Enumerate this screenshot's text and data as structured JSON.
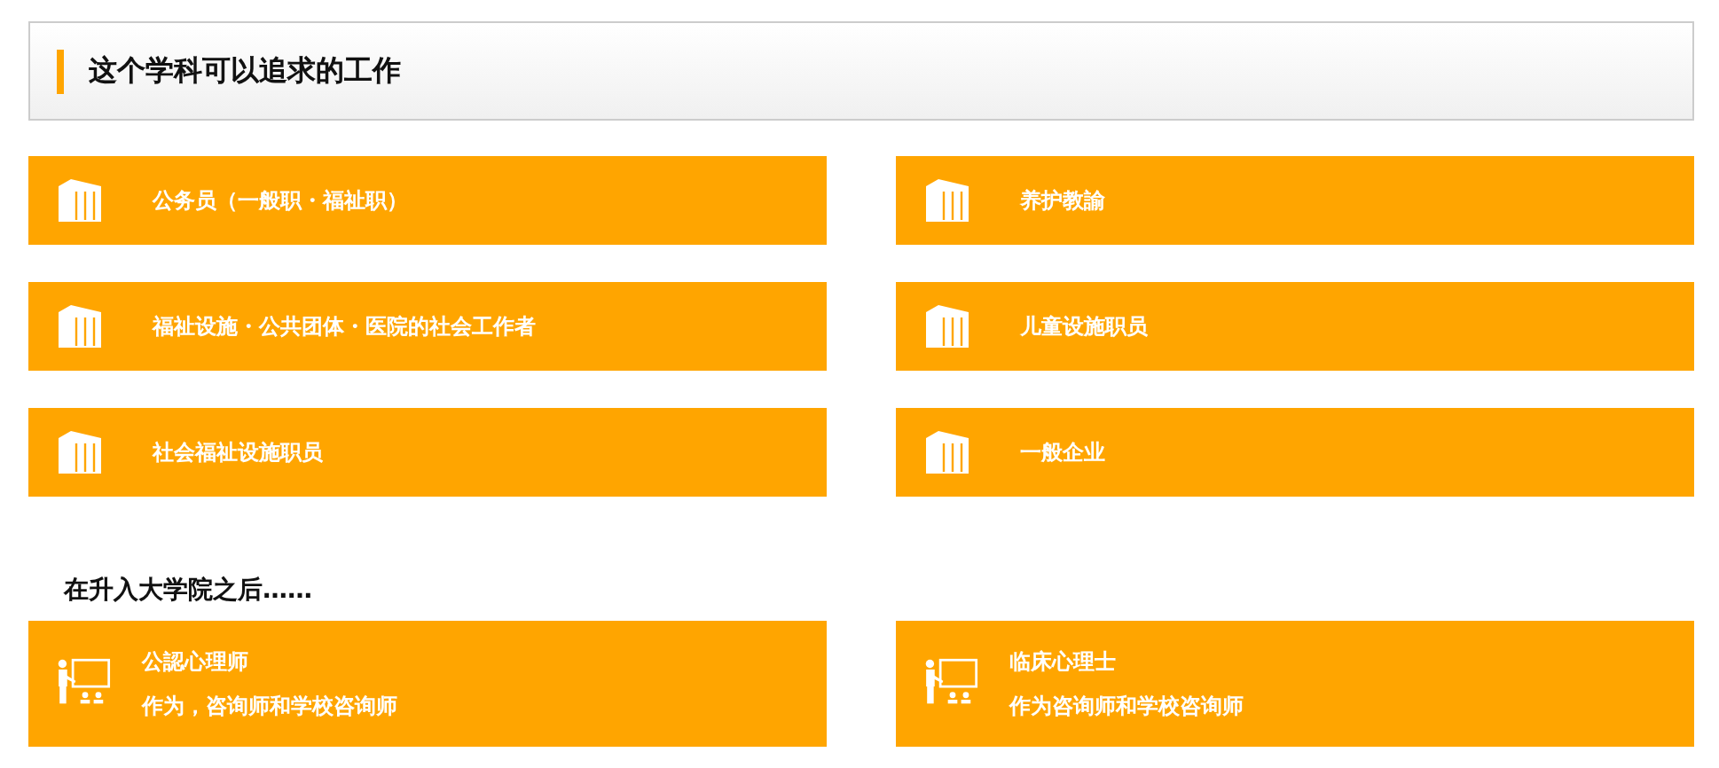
{
  "header": {
    "title": "这个学科可以追求的工作"
  },
  "careers": [
    {
      "kind": "building",
      "title": "公务员（一般职・福祉职）"
    },
    {
      "kind": "building",
      "title": "养护教諭"
    },
    {
      "kind": "building",
      "title": "福祉设施・公共团体・医院的社会工作者"
    },
    {
      "kind": "building",
      "title": "儿童设施职员"
    },
    {
      "kind": "building",
      "title": "社会福祉设施职员"
    },
    {
      "kind": "building",
      "title": "一般企业"
    }
  ],
  "graduate": {
    "heading": "在升入大学院之后……",
    "careers": [
      {
        "kind": "teacher",
        "title": "公認心理师",
        "subtitle": "作为，咨询师和学校咨询师"
      },
      {
        "kind": "teacher",
        "title": "临床心理士",
        "subtitle": "作为咨询师和学校咨询师"
      }
    ]
  }
}
